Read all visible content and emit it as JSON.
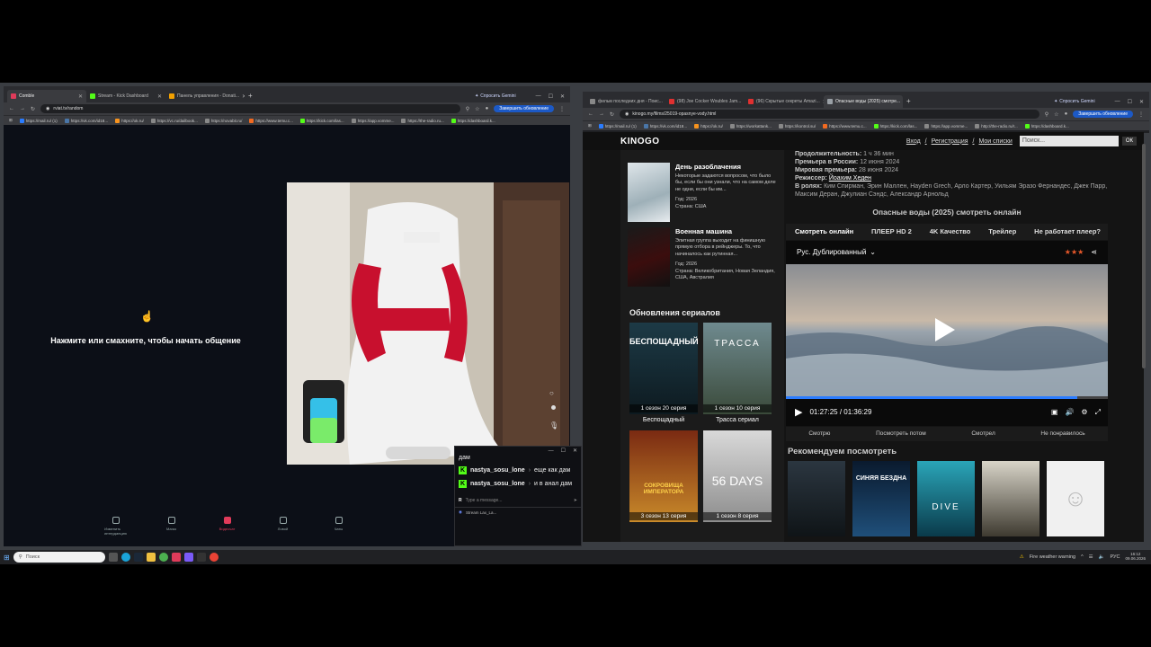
{
  "left_window": {
    "tabs": [
      {
        "label": "Comble",
        "color": "#e03b5a",
        "active": true
      },
      {
        "label": "Stream - Kick Dashboard",
        "color": "#53fc18",
        "active": false
      },
      {
        "label": "Панель управления - Donati...",
        "color": "#f2a000",
        "active": false
      }
    ],
    "gemini": "Спросить Gemini",
    "url": "rviat.tv/random",
    "update": "Завершить обновление",
    "bookmarks": [
      "https://mail.ru/ (1)",
      "https://vk.com/id18...",
      "https://ok.ru/",
      "https://vc.ru/dailbook...",
      "https://novabit.ru/",
      "https://www.temu.c...",
      "https://kick.com/las...",
      "https://app.vomme...",
      "https://the-radio.ru...",
      "https://dashboard.k..."
    ],
    "prompt": "Нажмите или смахните, чтобы начать общение",
    "bottom_nav": [
      "Изменить интерданцию",
      "Магаз",
      "Видеочат",
      "Ловой",
      "Чаты"
    ]
  },
  "chat": {
    "partial_user": "nastya_sosu_lone",
    "partial_text": "дам",
    "messages": [
      {
        "user": "nastya_sosu_lone",
        "text": "еще как дам"
      },
      {
        "user": "nastya_sosu_lone",
        "text": "и в анал дам"
      }
    ],
    "input_placeholder": "Type a message...",
    "footer": "Stream Lax_La..."
  },
  "right_window": {
    "tabs": [
      {
        "label": "фильм последних дня - Поис...",
        "color": "#888888",
        "active": false
      },
      {
        "label": "(98) Joe Cocker Woubles Jam...",
        "color": "#e03030",
        "active": false
      },
      {
        "label": "(96) Скрытые секреты Amazi...",
        "color": "#e03030",
        "active": false
      },
      {
        "label": "Опасные воды (2025) смотре...",
        "color": "#9aa0a6",
        "active": true
      }
    ],
    "gemini": "Спросить Gemini",
    "url": "kinogo.my/films/25019-opasnye-vody.html",
    "update": "Завершить обновление",
    "bookmarks": [
      "https://mail.ru/ (1)",
      "https://vk.com/id18...",
      "https://ok.ru/",
      "https://workattank...",
      "https://kontrol.su/",
      "https://www.temu.c...",
      "https://kick.com/las...",
      "https://app.vomme...",
      "http://the-radio.ru/r...",
      "https://dashboard.k..."
    ]
  },
  "kinogo": {
    "logo": "KINOGO",
    "links": [
      "Вход",
      "Регистрация",
      "Мои списки"
    ],
    "search_placeholder": "Поиск...",
    "ok": "ОК",
    "side_movies": [
      {
        "title": "День разоблачения",
        "desc": "Некоторые задаются вопросом, что было бы, если бы они узнали, что на самом деле не одни, если бы им...",
        "year": "Год: 2026",
        "country": "Страна: США"
      },
      {
        "title": "Военная машина",
        "desc": "Элитная группа выходит на финишную прямую отбора в рейнджеры. То, что начиналось как рутинная...",
        "year": "Год: 2026",
        "country": "Страна: Великобритания, Новая Зеландия, США, Австралия"
      }
    ],
    "series_title": "Обновления сериалов",
    "series": [
      {
        "name": "Беспощадный",
        "badge": "1 сезон 20 серия",
        "poster_text": "БЕСПОЩАДНЫЙ"
      },
      {
        "name": "Трасса сериал",
        "badge": "1 сезон 10 серия",
        "poster_text": "ТРАССА"
      },
      {
        "name": "",
        "badge": "3 сезон 13 серия",
        "poster_text": "СОКРОВИЩА ИМПЕРАТОРА"
      },
      {
        "name": "",
        "badge": "1 сезон 8 серия",
        "poster_text": "56 DAYS"
      }
    ],
    "info": {
      "duration_label": "Продолжительность:",
      "duration": "1 ч 36 мин",
      "premiere_ru_label": "Премьера в России:",
      "premiere_ru": "12 июня 2024",
      "premiere_world_label": "Мировая премьера:",
      "premiere_world": "28 июня 2024",
      "director_label": "Режиссер:",
      "director": "Йоахим Хеден",
      "cast_label": "В ролях:",
      "cast": "Ким Спирман, Эрин Маллен, Hayden Grech, Арло Картер, Уильям Эразо Фернандес, Джек Парр, Максим Деран, Джулиан Сэндс, Александр Арнольд"
    },
    "watch_title": "Опасные воды (2025) смотреть онлайн",
    "player_tabs": [
      "Смотреть онлайн",
      "ПЛЕЕР HD 2",
      "4K Качество",
      "Трейлер",
      "Не работает плеер?"
    ],
    "dub": "Рус. Дублированный",
    "time": "01:27:25 / 01:36:29",
    "progress": 0.906,
    "rating_buttons": [
      "Смотрю",
      "Посмотреть потом",
      "Смотрел",
      "Не понравилось"
    ],
    "recommend_title": "Рекомендуем посмотреть",
    "rec_posters": [
      "",
      "СИНЯЯ БЕЗДНА",
      "DIVE",
      "",
      ""
    ]
  },
  "taskbar": {
    "search": "Поиск",
    "weather": "Fire weather warning",
    "lang": "РУС",
    "time": "16:12",
    "date": "09.06.2026"
  }
}
